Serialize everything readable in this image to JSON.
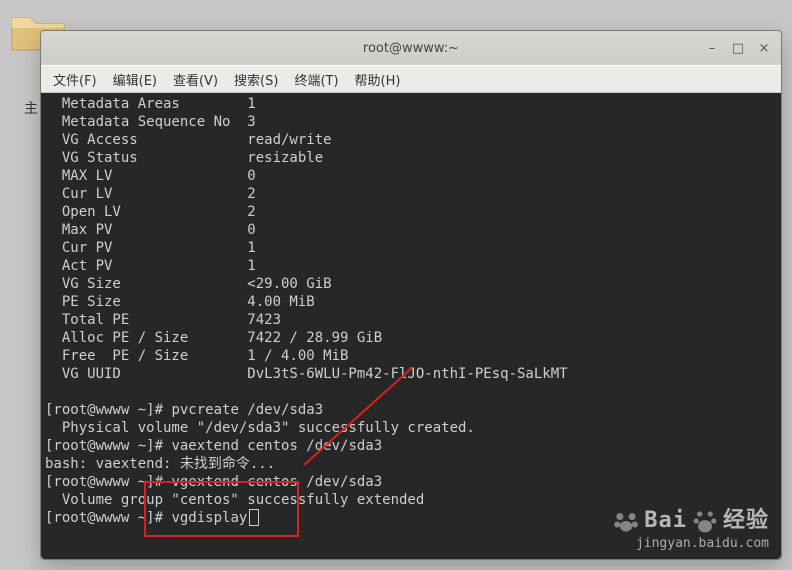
{
  "window": {
    "title": "root@wwww:~",
    "controls": {
      "min": "–",
      "max": "□",
      "close": "×"
    }
  },
  "menu": {
    "file": "文件(F)",
    "edit": "编辑(E)",
    "view": "查看(V)",
    "search": "搜索(S)",
    "term": "终端(T)",
    "help": "帮助(H)"
  },
  "trunc_label": "主",
  "terminal": {
    "l01": "  Metadata Areas        1",
    "l02": "  Metadata Sequence No  3",
    "l03": "  VG Access             read/write",
    "l04": "  VG Status             resizable",
    "l05": "  MAX LV                0",
    "l06": "  Cur LV                2",
    "l07": "  Open LV               2",
    "l08": "  Max PV                0",
    "l09": "  Cur PV                1",
    "l10": "  Act PV                1",
    "l11": "  VG Size               <29.00 GiB",
    "l12": "  PE Size               4.00 MiB",
    "l13": "  Total PE              7423",
    "l14": "  Alloc PE / Size       7422 / 28.99 GiB",
    "l15": "  Free  PE / Size       1 / 4.00 MiB",
    "l16": "  VG UUID               DvL3tS-6WLU-Pm42-FlJO-nthI-PEsq-SaLkMT",
    "l17": "",
    "p1_a": "[root@wwww ~]# ",
    "p1_b": "pvcreate /dev/sda3",
    "l19": "  Physical volume \"/dev/sda3\" successfully created.",
    "p2_a": "[root@wwww ~]# ",
    "p2_b": "vaextend centos /dev/sda3",
    "l21": "bash: vaextend: 未找到命令...",
    "p3_a": "[root@wwww ~]# ",
    "p3_b": "vgextend centos /dev/sda3",
    "l23": "  Volume group \"centos\" successfully extended",
    "p4_a": "[root@wwww ~]# ",
    "p4_b": "vgdisplay"
  },
  "watermark": {
    "brand": "Bai",
    "brand2": "经验",
    "url": "jingyan.baidu.com"
  },
  "colors": {
    "annotation": "#dc1f1f",
    "term_bg": "#272727",
    "term_fg": "#cfcfcf"
  }
}
